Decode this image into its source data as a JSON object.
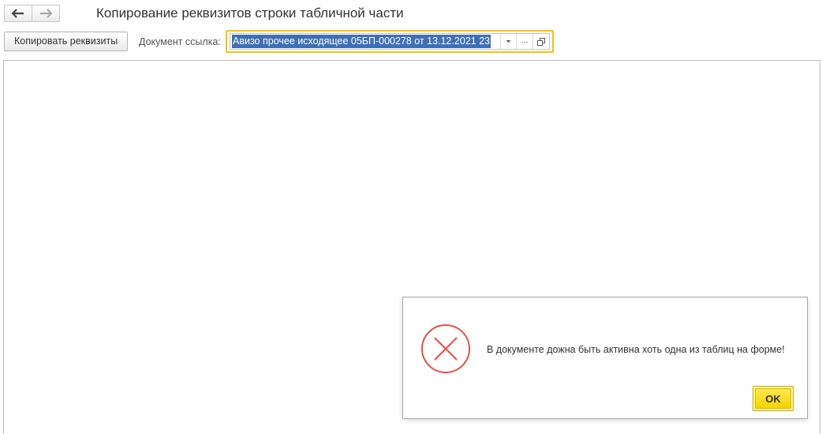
{
  "header": {
    "title": "Копирование реквизитов строки табличной части",
    "nav": {
      "back_icon": "arrow-left-icon",
      "forward_icon": "arrow-right-icon"
    }
  },
  "toolbar": {
    "copy_button_label": "Копировать реквизиты",
    "doc_link_label": "Документ ссылка:",
    "doc_link_value": "Авизо прочее исходящее 05БП-000278 от 13.12.2021 23",
    "dropdown_icon": "chevron-down-icon",
    "select_button_label": "...",
    "open_icon": "open-window-icon"
  },
  "dialog": {
    "icon": "error-cross-icon",
    "message": "В документе дожна быть активна хоть одна из таблиц на форме!",
    "ok_label": "OK"
  },
  "colors": {
    "accent_yellow": "#f1c40f",
    "selection_blue": "#3f6fb5",
    "error_red": "#e8504a",
    "ok_button": "#f5d300"
  }
}
